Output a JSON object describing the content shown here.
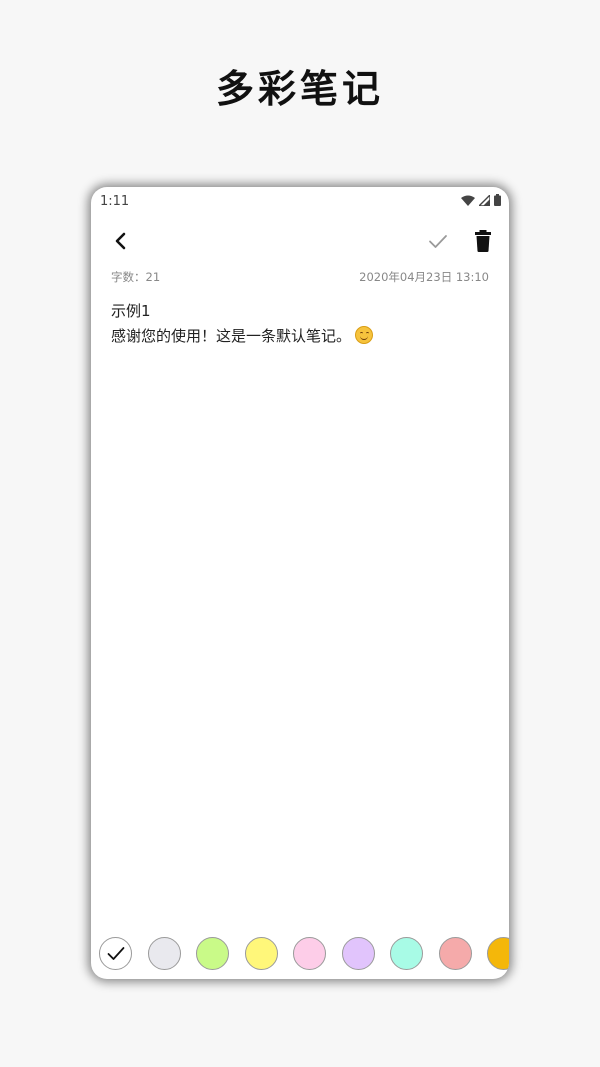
{
  "headline": "多彩笔记",
  "status_bar": {
    "time": "1:11",
    "icons": [
      "wifi-icon",
      "signal-icon",
      "battery-icon"
    ]
  },
  "toolbar": {
    "back_icon": "chevron-left-icon",
    "save_icon": "check-icon",
    "delete_icon": "trash-icon"
  },
  "note": {
    "word_count": "字数：21",
    "timestamp": "2020年04月23日 13:10",
    "title": "示例1",
    "body": "感谢您的使用！这是一条默认笔记。",
    "body_emoji": "smiling-face-icon"
  },
  "palette": {
    "selected_index": 0,
    "colors": [
      "#ffffff",
      "#e9e9ee",
      "#c9fa88",
      "#fff77a",
      "#fdcde8",
      "#e1c4fc",
      "#a8fbe6",
      "#f5aaaa",
      "#f4b70a"
    ]
  },
  "colors": {
    "background": "#f7f7f7",
    "card": "#ffffff",
    "meta_text": "#888888"
  }
}
